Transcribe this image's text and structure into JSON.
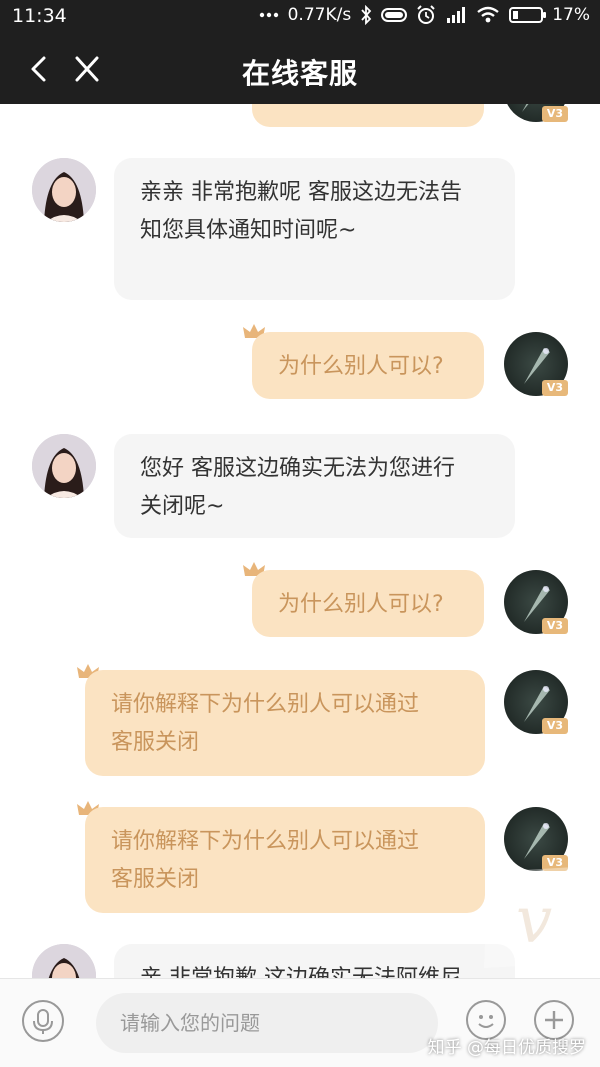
{
  "status_bar": {
    "time": "11:34",
    "network_speed": "0.77K/s",
    "battery": "17%",
    "icons": [
      "signal-dots-icon",
      "bluetooth-icon",
      "toggle-icon",
      "alarm-icon",
      "hd-signal-icon",
      "wifi-icon",
      "battery-icon"
    ]
  },
  "nav": {
    "title": "在线客服",
    "back_icon": "chevron-left-icon",
    "close_icon": "close-icon"
  },
  "badge_text": "V3",
  "messages": [
    {
      "sender": "agent",
      "lines": [
        "亲亲 非常抱歉呢 客服这边无法告",
        "知您具体通知时间呢~"
      ]
    },
    {
      "sender": "user",
      "lines": [
        "为什么别人可以?"
      ]
    },
    {
      "sender": "agent",
      "lines": [
        "您好 客服这边确实无法为您进行",
        "关闭呢~"
      ]
    },
    {
      "sender": "user",
      "lines": [
        "为什么别人可以?"
      ]
    },
    {
      "sender": "user",
      "lines": [
        "请你解释下为什么别人可以通过",
        "客服关闭"
      ]
    },
    {
      "sender": "user",
      "lines": [
        "请你解释下为什么别人可以通过",
        "客服关闭"
      ]
    },
    {
      "sender": "agent",
      "lines": [
        "亲 非常抱歉 这边确实无法阿维尼"
      ]
    }
  ],
  "input": {
    "placeholder": "请输入您的问题"
  },
  "watermark": "知乎 @每日优质搜罗",
  "colors": {
    "header_bg": "#1f1f1f",
    "user_bubble": "#fbe3c2",
    "user_text": "#c9955c",
    "agent_bubble": "#f5f5f5",
    "badge": "#e7b87a"
  }
}
